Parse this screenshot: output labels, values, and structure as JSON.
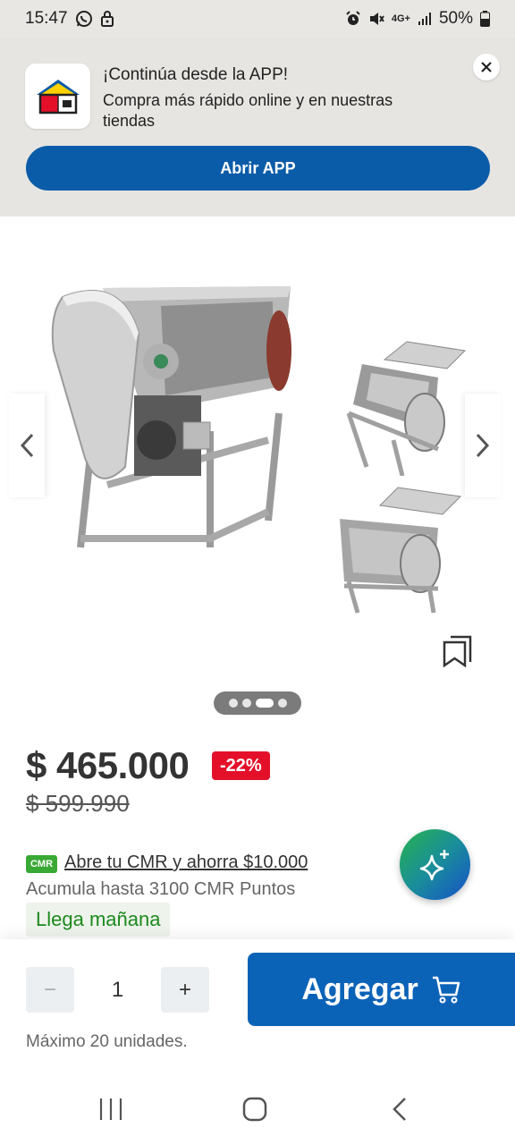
{
  "status_bar": {
    "time": "15:47",
    "network": "4G+",
    "battery": "50%",
    "icons": [
      "whatsapp-icon",
      "lock-icon",
      "alarm-icon",
      "mute-icon",
      "signal-icon",
      "battery-icon"
    ]
  },
  "app_banner": {
    "title": "¡Continúa desde la APP!",
    "subtitle": "Compra más rápido online y en nuestras tiendas",
    "button_label": "Abrir APP",
    "close_icon": "close-icon"
  },
  "gallery": {
    "page_count": 4,
    "active_page": 3
  },
  "product": {
    "price": "$ 465.000",
    "discount": "-22%",
    "old_price": "$ 599.990",
    "cmr_badge": "CMR",
    "cmr_link": "Abre tu CMR y ahorra $10.000",
    "cmr_points": "Acumula hasta 3100 CMR Puntos",
    "delivery": "Llega mañana"
  },
  "cart": {
    "minus": "−",
    "quantity": "1",
    "plus": "+",
    "add_label": "Agregar",
    "max_units": "Máximo 20 unidades."
  },
  "colors": {
    "brand_blue": "#0b63b8",
    "discount_red": "#e4102a",
    "cmr_green": "#39a935",
    "delivery_green": "#1d8a1d"
  }
}
